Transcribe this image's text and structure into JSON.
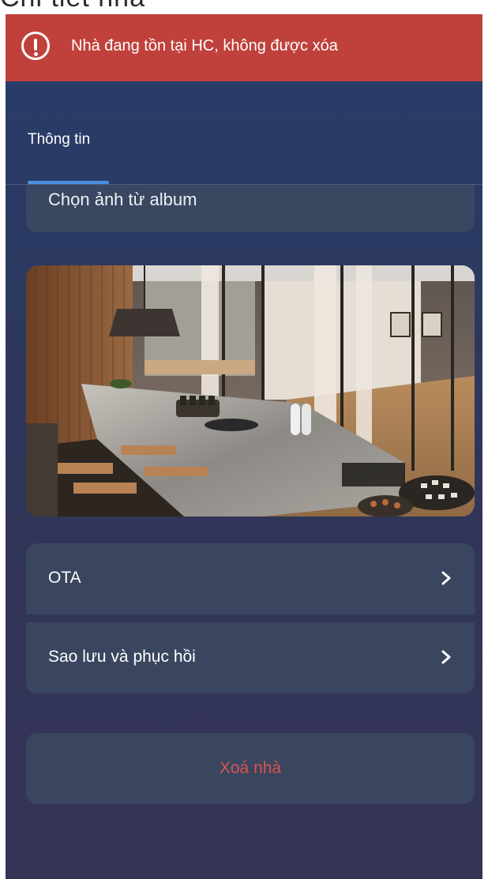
{
  "top_peek_text": "Chi tiết nhà",
  "toast": {
    "icon": "alert-circle-icon",
    "message": "Nhà đang tồn tại HC, không được xóa",
    "color": "#c0413c"
  },
  "tabs": [
    {
      "label": "Thông tin",
      "active": true
    }
  ],
  "album_button": {
    "label": "Chọn ảnh từ album"
  },
  "house_photo": {
    "alt": "kitchen interior photo"
  },
  "menu": [
    {
      "label": "OTA",
      "icon": "chevron-right-icon"
    },
    {
      "label": "Sao lưu và phục hồi",
      "icon": "chevron-right-icon"
    }
  ],
  "delete_button": {
    "label": "Xoá nhà",
    "color": "#d9534f"
  },
  "colors": {
    "background_top": "#283d6a",
    "background_bottom": "#343456",
    "card": "#3a465f",
    "tab_indicator": "#4a90e2"
  }
}
